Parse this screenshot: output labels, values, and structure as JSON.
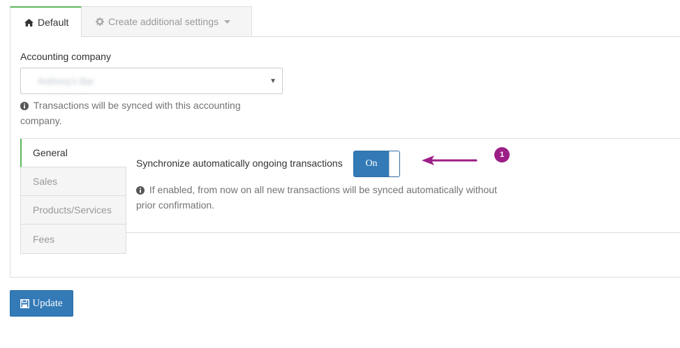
{
  "tabs": {
    "default_label": "Default",
    "default_icon": "home-icon",
    "additional_label": "Create additional settings",
    "additional_icon": "gear-icon"
  },
  "company": {
    "label": "Accounting company",
    "selected_value": "Anthony's Bar",
    "help_text": "Transactions will be synced with this accounting company."
  },
  "side_tabs": [
    {
      "label": "General",
      "active": true
    },
    {
      "label": "Sales",
      "active": false
    },
    {
      "label": "Products/Services",
      "active": false
    },
    {
      "label": "Fees",
      "active": false
    }
  ],
  "sync": {
    "label": "Synchronize automatically ongoing transactions",
    "toggle_state": "On",
    "help_text": "If enabled, from now on all new transactions will be synced automatically without prior confirmation."
  },
  "annotation": {
    "marker_number": "1",
    "color": "#9c1e87"
  },
  "update_button": {
    "label": "Update",
    "icon": "save-icon"
  },
  "colors": {
    "accent_green": "#5cb85c",
    "primary_blue": "#337ab7"
  }
}
